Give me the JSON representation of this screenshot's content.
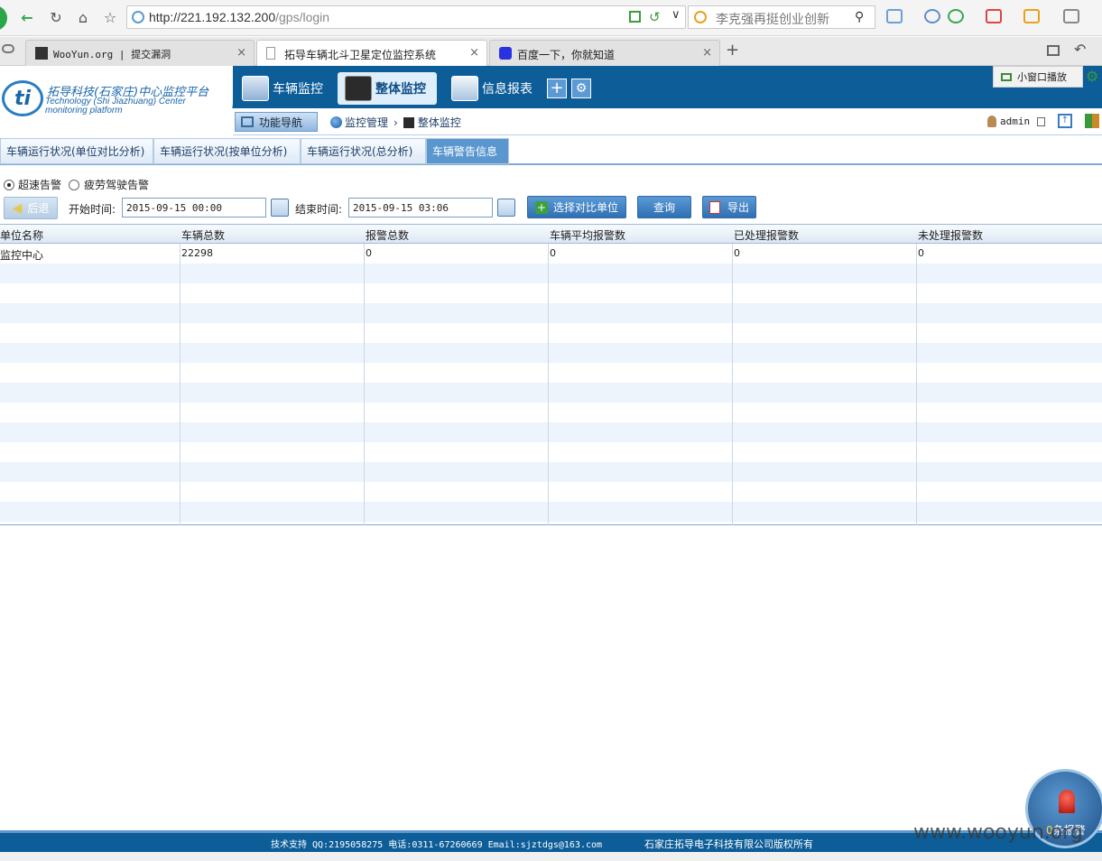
{
  "browser": {
    "url_host": "http://221.192.132.200",
    "url_path": "/gps/login",
    "search_text": "李克强再挺创业创新",
    "tabs": [
      {
        "title": "WooYun.org | 提交漏洞"
      },
      {
        "title": "拓导车辆北斗卫星定位监控系统"
      },
      {
        "title": "百度一下，你就知道"
      }
    ]
  },
  "app": {
    "logo_title": "拓导科技(石家庄)中心监控平台",
    "logo_sub1": "Technology (Shi Jiazhuang) Center",
    "logo_sub2": "monitoring platform",
    "nav": [
      {
        "label": "车辆监控"
      },
      {
        "label": "整体监控"
      },
      {
        "label": "信息报表"
      }
    ],
    "small_window": "小窗口播放",
    "func_nav": "功能导航",
    "breadcrumb": [
      "监控管理",
      "整体监控"
    ],
    "user": "admin"
  },
  "page_tabs": [
    {
      "label": "车辆运行状况(单位对比分析)"
    },
    {
      "label": "车辆运行状况(按单位分析)"
    },
    {
      "label": "车辆运行状况(总分析)"
    },
    {
      "label": "车辆警告信息"
    }
  ],
  "filters": {
    "radio_overspeed": "超速告警",
    "radio_fatigue": "疲劳驾驶告警",
    "back": "后退",
    "start_label": "开始时间:",
    "start_value": "2015-09-15 00:00",
    "end_label": "结束时间:",
    "end_value": "2015-09-15 03:06",
    "select_units": "选择对比单位",
    "query": "查询",
    "export": "导出"
  },
  "table": {
    "columns": [
      "单位名称",
      "车辆总数",
      "报警总数",
      "车辆平均报警数",
      "已处理报警数",
      "未处理报警数"
    ],
    "rows": [
      [
        "监控中心",
        "22298",
        "0",
        "0",
        "0",
        "0"
      ]
    ]
  },
  "footer": {
    "support": "技术支持 QQ:2195058275 电话:0311-67260669 Email:sjztdgs@163.com",
    "copyright": "石家庄拓导电子科技有限公司版权所有"
  },
  "alarm": {
    "count": "0",
    "suffix": "条报警"
  },
  "watermark": "www.wooyun.org"
}
